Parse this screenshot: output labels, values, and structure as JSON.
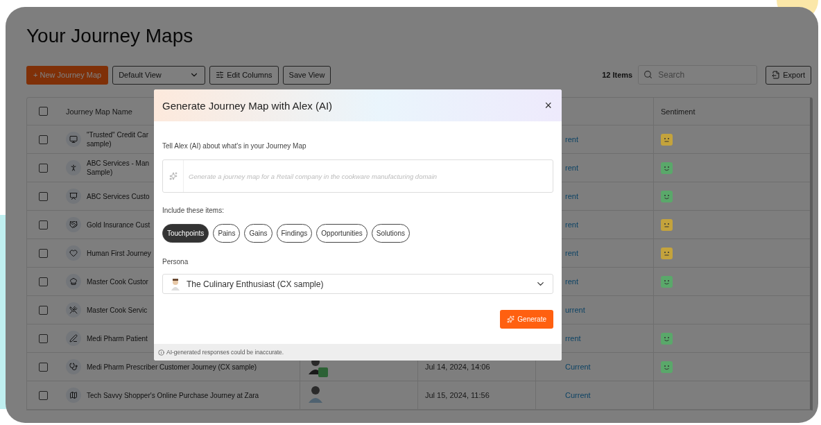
{
  "page": {
    "title": "Your Journey Maps"
  },
  "toolbar": {
    "new_button": "+ New Journey Map",
    "view_select": "Default View",
    "edit_columns": "Edit Columns",
    "save_view": "Save View",
    "item_count": "12 Items",
    "search": {
      "placeholder": "Search"
    },
    "export": "Export"
  },
  "table": {
    "select_all_checked": false,
    "columns": {
      "name": "Journey Map Name",
      "sentiment": "Sentiment"
    },
    "rows": [
      {
        "checked": false,
        "name": [
          "\"Trusted\" Credit Car",
          "sample)"
        ],
        "status": "rent",
        "sentiment": {
          "color": "#c4a33c",
          "positive": false
        }
      },
      {
        "checked": false,
        "name": [
          "ABC Services - Man",
          "Sample)"
        ],
        "status": "rent",
        "sentiment": {
          "color": "#5aa86a",
          "positive": true
        }
      },
      {
        "checked": false,
        "name": [
          "ABC Services Custo"
        ],
        "status": "rent",
        "sentiment": {
          "color": "#5aa86a",
          "positive": true
        }
      },
      {
        "checked": false,
        "name": [
          "Gold Insurance Cust"
        ],
        "status": "rent",
        "sentiment": {
          "color": "#c4a33c",
          "positive": false
        }
      },
      {
        "checked": false,
        "name": [
          "Human First Journey"
        ],
        "status": "rent",
        "sentiment": {
          "color": "#c4a33c",
          "positive": false
        }
      },
      {
        "checked": false,
        "name": [
          "Master Cook Custor"
        ],
        "status": "rent",
        "sentiment": {
          "color": "#5aa86a",
          "positive": true
        }
      },
      {
        "checked": false,
        "name": [
          "Master Cook Servic"
        ],
        "status": "urrent"
      },
      {
        "checked": false,
        "name": [
          "Medi Pharm Patient"
        ],
        "status": "rrent",
        "sentiment": {
          "color": "#5aa86a",
          "positive": true
        }
      },
      {
        "checked": false,
        "name": [
          "Medi Pharm Prescriber Customer Journey (CX sample)"
        ],
        "persona_badge": true,
        "date": "Jul 14, 2024, 14:06",
        "status": "Current",
        "sentiment": {
          "color": "#5aa86a",
          "positive": true
        }
      },
      {
        "checked": false,
        "name": [
          "Tech Savvy Shopper's Online Purchase Journey at Zara"
        ],
        "persona_badge": false,
        "date": "Jul 15, 2024, 11:56",
        "status": "Current"
      }
    ]
  },
  "modal": {
    "title": "Generate Journey Map with Alex (AI)",
    "close": "×",
    "prompt_label": "Tell Alex (AI) about what's in your Journey Map",
    "prompt": {
      "placeholder": "Generate a journey map for a Retail company in the cookware manufacturing domain"
    },
    "items_label": "Include these items:",
    "items": [
      {
        "label": "Touchpoints",
        "selected": true
      },
      {
        "label": "Pains",
        "selected": false
      },
      {
        "label": "Gains",
        "selected": false
      },
      {
        "label": "Findings",
        "selected": false
      },
      {
        "label": "Opportunities",
        "selected": false
      },
      {
        "label": "Solutions",
        "selected": false
      }
    ],
    "persona_label": "Persona",
    "persona": {
      "value": "The Culinary Enthusiast (CX sample)"
    },
    "generate": "Generate",
    "note": "AI-generated responses could be inaccurate."
  }
}
